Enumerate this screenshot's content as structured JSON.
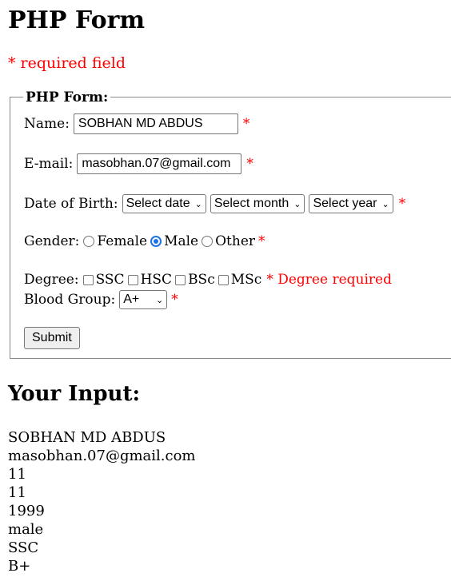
{
  "page": {
    "title": "PHP Form",
    "required_note": "* required field"
  },
  "form": {
    "legend": "PHP Form:",
    "name_label": "Name:",
    "name_value": "SOBHAN MD ABDUS",
    "email_label": "E-mail:",
    "email_value": "masobhan.07@gmail.com",
    "dob_label": "Date of Birth:",
    "dob_day": "Select date",
    "dob_month": "Select month",
    "dob_year": "Select year",
    "gender_label": "Gender:",
    "gender_options": [
      "Female",
      "Male",
      "Other"
    ],
    "gender_selected": "Male",
    "degree_label": "Degree:",
    "degree_options": [
      "SSC",
      "HSC",
      "BSc",
      "MSc"
    ],
    "degree_error": "* Degree required",
    "blood_label": "Blood Group:",
    "blood_value": "A+",
    "star": "*",
    "submit_label": "Submit"
  },
  "output": {
    "title": "Your Input:",
    "lines": [
      "SOBHAN MD ABDUS",
      "masobhan.07@gmail.com",
      "11",
      "11",
      "1999",
      "male",
      "SSC",
      "B+"
    ]
  }
}
